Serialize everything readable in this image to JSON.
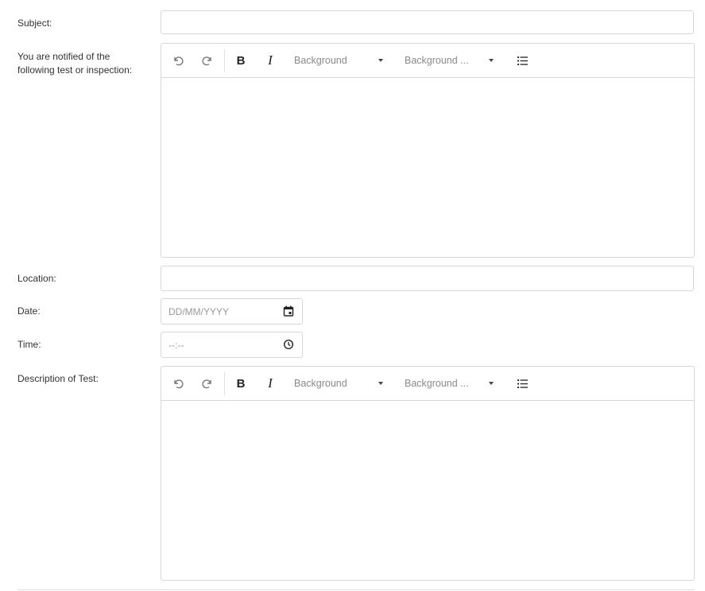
{
  "form": {
    "subject_label": "Subject:",
    "notified_label_line1": "You are notified of the",
    "notified_label_line2": "following test or inspection:",
    "location_label": "Location:",
    "date_label": "Date:",
    "date_placeholder": "DD/MM/YYYY",
    "time_label": "Time:",
    "time_placeholder": "--:--",
    "description_label": "Description of Test:"
  },
  "editor_toolbar": {
    "bold": "B",
    "italic": "I",
    "background_dropdown_1": "Background",
    "background_dropdown_2": "Background ..."
  },
  "icons": {
    "undo": "undo-icon",
    "redo": "redo-icon",
    "calendar": "calendar-icon",
    "clock": "clock-icon",
    "list": "bullet-list-icon"
  }
}
